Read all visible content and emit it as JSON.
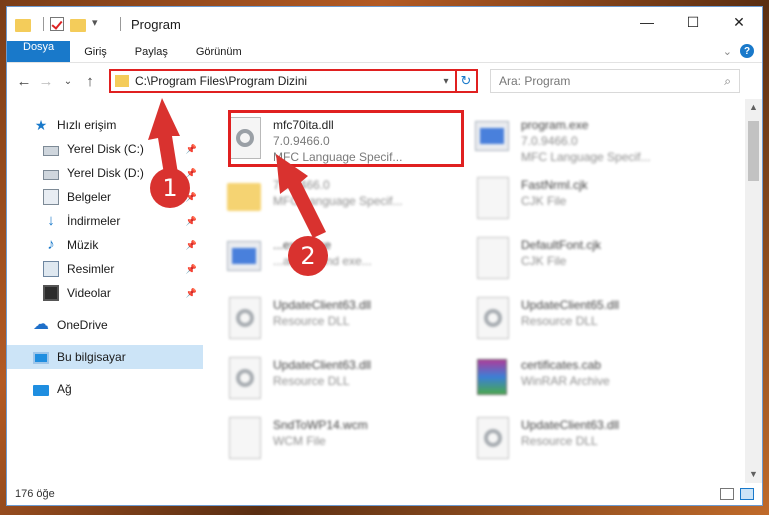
{
  "window": {
    "title": "Program",
    "controls": {
      "minimize": "—",
      "maximize": "☐",
      "close": "✕"
    }
  },
  "ribbon": {
    "tabs": [
      "Dosya",
      "Giriş",
      "Paylaş",
      "Görünüm"
    ],
    "expand_icon": "chevron-down-icon",
    "help": "?"
  },
  "nav": {
    "back": "←",
    "forward": "→",
    "recent": "⌄",
    "up": "↑",
    "address": "C:\\Program Files\\Program Dizini",
    "refresh": "↻",
    "search_placeholder": "Ara: Program",
    "search_icon": "⌕"
  },
  "sidebar": {
    "quick_access": "Hızlı erişim",
    "items": [
      {
        "label": "Yerel Disk (C:)",
        "icon": "drive-icon"
      },
      {
        "label": "Yerel Disk (D:)",
        "icon": "drive-icon"
      },
      {
        "label": "Belgeler",
        "icon": "documents-icon"
      },
      {
        "label": "İndirmeler",
        "icon": "downloads-icon"
      },
      {
        "label": "Müzik",
        "icon": "music-icon"
      },
      {
        "label": "Resimler",
        "icon": "pictures-icon"
      },
      {
        "label": "Videolar",
        "icon": "videos-icon"
      }
    ],
    "onedrive": "OneDrive",
    "this_pc": "Bu bilgisayar",
    "network": "Ağ"
  },
  "files": [
    {
      "name": "mfc70ita.dll",
      "line2": "7.0.9466.0",
      "line3": "MFC Language Specif...",
      "icon": "dll"
    },
    {
      "name": "program.exe",
      "line2": "7.0.9466.0",
      "line3": "MFC Language Specif...",
      "icon": "exe"
    },
    {
      "name": "",
      "line2": "7.0.9466.0",
      "line3": "MFC Language Specif...",
      "icon": "folder"
    },
    {
      "name": "FastNrml.cjk",
      "line2": "CJK File",
      "line3": "",
      "icon": "doc"
    },
    {
      "name": "...exec.exe",
      "line2": "...ackground exe...",
      "line3": "",
      "icon": "exe"
    },
    {
      "name": "DefaultFont.cjk",
      "line2": "CJK File",
      "line3": "",
      "icon": "doc"
    },
    {
      "name": "UpdateClient63.dll",
      "line2": "Resource DLL",
      "line3": "",
      "icon": "dll"
    },
    {
      "name": "UpdateClient65.dll",
      "line2": "Resource DLL",
      "line3": "",
      "icon": "dll"
    },
    {
      "name": "UpdateClient63.dll",
      "line2": "Resource DLL",
      "line3": "",
      "icon": "dll"
    },
    {
      "name": "certificates.cab",
      "line2": "WinRAR Archive",
      "line3": "",
      "icon": "cab"
    },
    {
      "name": "SndToWP14.wcm",
      "line2": "WCM File",
      "line3": "",
      "icon": "doc"
    },
    {
      "name": "UpdateClient63.dll",
      "line2": "Resource DLL",
      "line3": "",
      "icon": "dll"
    }
  ],
  "status": {
    "count": "176 öğe"
  },
  "callouts": [
    "1",
    "2"
  ],
  "colors": {
    "accent": "#1979ca",
    "callout": "#d9322f",
    "highlight": "#e02020"
  }
}
